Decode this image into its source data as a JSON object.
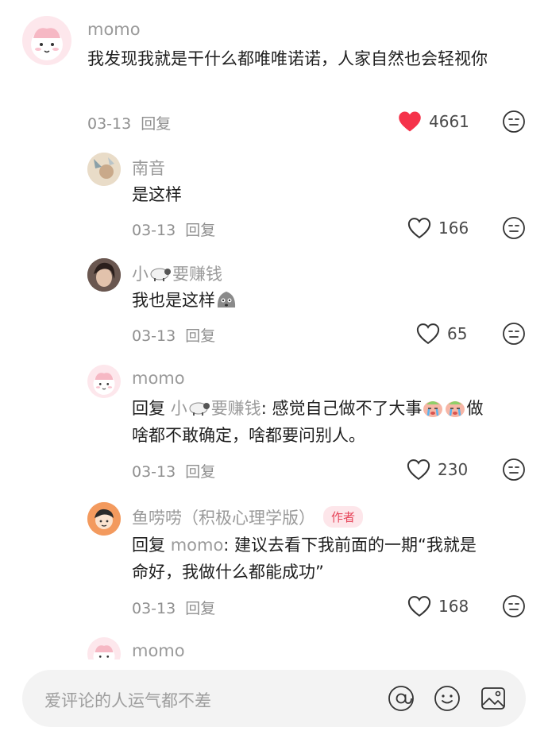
{
  "comments": [
    {
      "user": "momo",
      "text": "我发现我就是干什么都唯唯诺诺，人家自然也会轻视你",
      "date": "03-13",
      "reply_label": "回复",
      "likes": "4661",
      "liked": true
    },
    {
      "user": "南音",
      "text": "是这样",
      "date": "03-13",
      "reply_label": "回复",
      "likes": "166",
      "liked": false
    },
    {
      "user_prefix": "小",
      "user_suffix": "要赚钱",
      "text": "我也是这样",
      "date": "03-13",
      "reply_label": "回复",
      "likes": "65",
      "liked": false
    },
    {
      "user": "momo",
      "reply_word": "回复",
      "reply_target_prefix": "小",
      "reply_target_suffix": "要赚钱",
      "text_part1": ": 感觉自己做不了大事",
      "text_part2": "做",
      "text_line2": "啥都不敢确定，啥都要问别人。",
      "date": "03-13",
      "reply_label": "回复",
      "likes": "230",
      "liked": false
    },
    {
      "user": "鱼唠唠（积极心理学版）",
      "badge": "作者",
      "reply_word": "回复",
      "reply_target": "momo",
      "text_line1": ": 建议去看下我前面的一期“我就是",
      "text_line2": "命好，我做什么都能成功”",
      "date": "03-13",
      "reply_label": "回复",
      "likes": "168",
      "liked": false
    },
    {
      "user": "momo"
    }
  ],
  "input_bar": {
    "placeholder": "爱评论的人运气都不差"
  },
  "colors": {
    "heart_liked": "#f5324a",
    "author_badge": "#e6455a"
  },
  "icons": [
    "heart-icon",
    "neutral-face-icon",
    "at-icon",
    "emoji-icon",
    "image-icon"
  ]
}
